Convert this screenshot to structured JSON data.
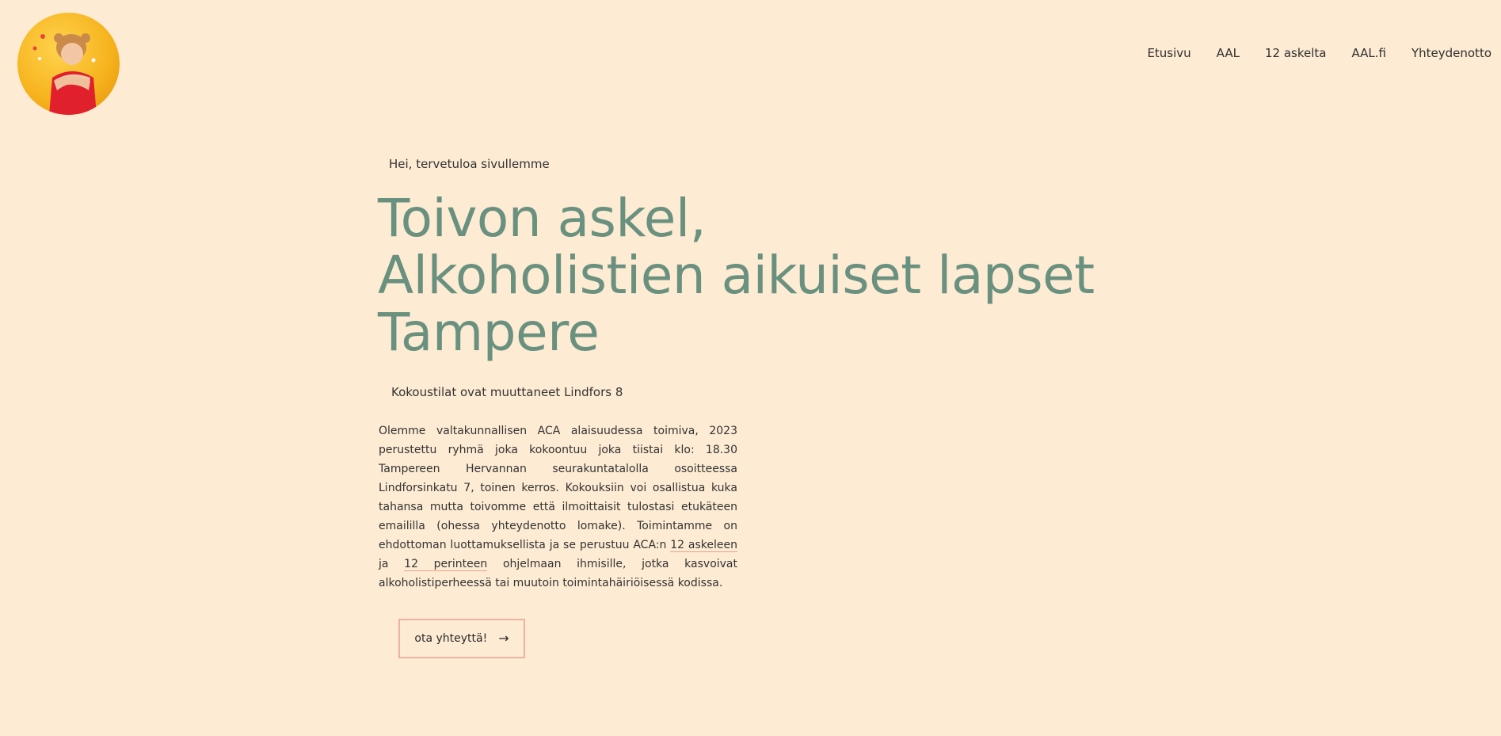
{
  "header": {
    "logo_alt": "Toivon askel logo",
    "nav": [
      {
        "label": "Etusivu"
      },
      {
        "label": "AAL"
      },
      {
        "label": "12 askelta"
      },
      {
        "label": "AAL.fi"
      },
      {
        "label": "Yhteydenotto"
      }
    ]
  },
  "hero": {
    "eyebrow": "Hei, tervetuloa sivullemme",
    "headline_line1": "Toivon askel,",
    "headline_line2": "Alkoholistien aikuiset lapset",
    "headline_line3": "Tampere",
    "notice": "Kokoustilat ovat muuttaneet Lindfors 8",
    "body_part1": "Olemme valtakunnallisen ACA alaisuudessa toimiva, 2023 perustettu ryhmä joka kokoontuu joka tiistai klo: 18.30 Tampereen Hervannan seurakuntatalolla osoitteessa Lindforsinkatu 7, toinen kerros. Kokouksiin voi osallistua kuka tahansa mutta toivomme että ilmoittaisit tulostasi etukäteen emaililla (ohessa yhteydenotto lomake). Toimintamme on ehdottoman luottamuksellista ja se perustuu ACA:n ",
    "link1": "12 askeleen",
    "body_part2": " ja ",
    "link2": "12 perinteen",
    "body_part3": " ohjelmaan ihmisille, jotka kasvoivat alkoholistiperheessä tai muutoin toimintahäiriöisessä kodissa.",
    "cta_label": "ota yhteyttä!",
    "cta_icon": "arrow-right-icon"
  },
  "colors": {
    "background": "#fdebd3",
    "headline": "#6a917f",
    "button_border": "#efb1a2"
  }
}
